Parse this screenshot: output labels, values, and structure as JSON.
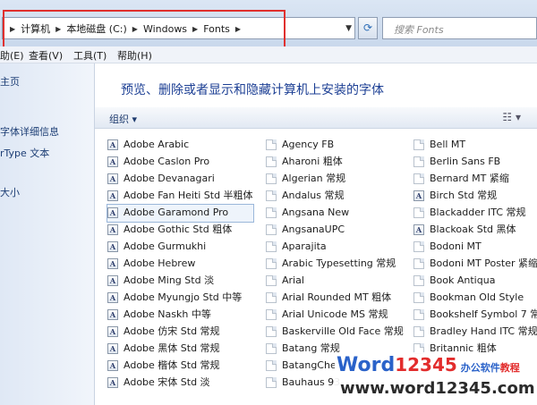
{
  "address": {
    "crumbs": [
      "计算机",
      "本地磁盘 (C:)",
      "Windows",
      "Fonts"
    ]
  },
  "search": {
    "placeholder": "搜索 Fonts"
  },
  "menu": [
    "助(E)",
    "查看(V)",
    "工具(T)",
    "帮助(H)"
  ],
  "nav": [
    "主页",
    "字体详细信息",
    "rType 文本",
    "大小"
  ],
  "content": {
    "heading": "预览、删除或者显示和隐藏计算机上安装的字体",
    "organize": "组织 ▾",
    "columns": [
      [
        "Adobe Arabic",
        "Adobe Caslon Pro",
        "Adobe Devanagari",
        "Adobe Fan Heiti Std 半粗体",
        "Adobe Garamond Pro",
        "Adobe Gothic Std 粗体",
        "Adobe Gurmukhi",
        "Adobe Hebrew",
        "Adobe Ming Std 淡",
        "Adobe Myungjo Std 中等",
        "Adobe Naskh 中等",
        "Adobe 仿宋 Std 常规",
        "Adobe 黑体 Std 常规",
        "Adobe 楷体 Std 常规",
        "Adobe 宋体 Std 淡"
      ],
      [
        "Agency FB",
        "Aharoni 粗体",
        "Algerian 常规",
        "Andalus 常规",
        "Angsana New",
        "AngsanaUPC",
        "Aparajita",
        "Arabic Typesetting 常规",
        "Arial",
        "Arial Rounded MT 粗体",
        "Arial Unicode MS 常规",
        "Baskerville Old Face 常规",
        "Batang 常规",
        "BatangChe",
        "Bauhaus 93"
      ],
      [
        "Bell MT",
        "Berlin Sans FB",
        "Bernard MT 紧缩",
        "Birch Std 常规",
        "Blackadder ITC 常规",
        "Blackoak Std 黑体",
        "Bodoni MT",
        "Bodoni MT Poster 紧缩",
        "Book Antiqua",
        "Bookman Old Style",
        "Bookshelf Symbol 7 常",
        "Bradley Hand ITC 常规",
        "Britannic 粗体",
        "",
        ""
      ]
    ]
  },
  "watermark": {
    "brand_word": "Word",
    "brand_num": "12345",
    "slogan_a": "办公软件",
    "slogan_b": "教程",
    "url": "www.word12345.com"
  }
}
